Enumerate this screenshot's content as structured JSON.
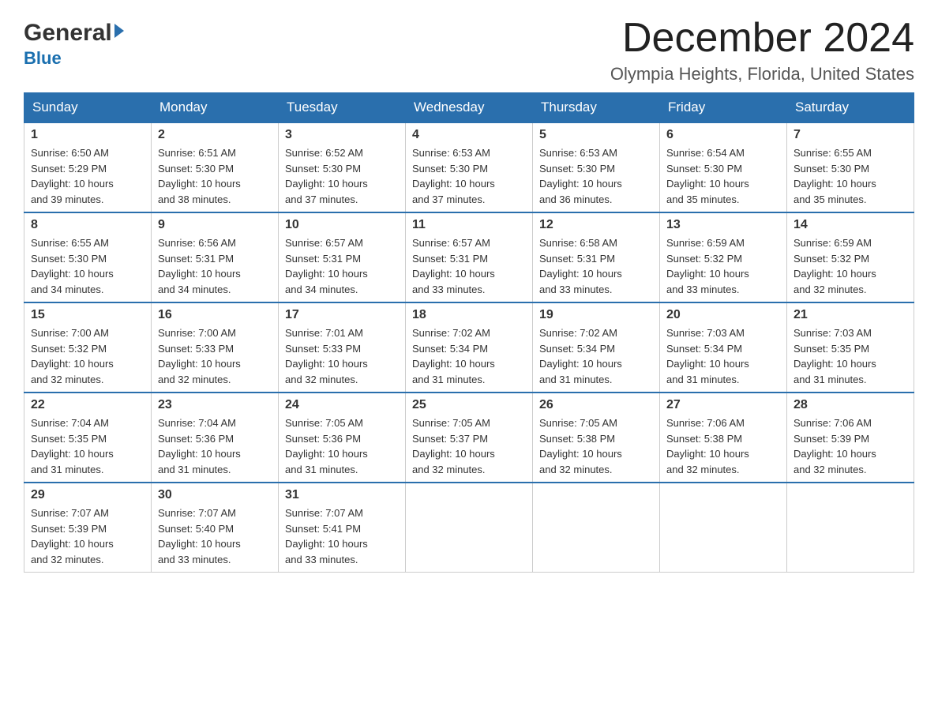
{
  "header": {
    "logo_general": "General",
    "logo_blue": "Blue",
    "month_title": "December 2024",
    "location": "Olympia Heights, Florida, United States"
  },
  "days_of_week": [
    "Sunday",
    "Monday",
    "Tuesday",
    "Wednesday",
    "Thursday",
    "Friday",
    "Saturday"
  ],
  "weeks": [
    [
      {
        "day": "1",
        "sunrise": "6:50 AM",
        "sunset": "5:29 PM",
        "daylight": "10 hours and 39 minutes."
      },
      {
        "day": "2",
        "sunrise": "6:51 AM",
        "sunset": "5:30 PM",
        "daylight": "10 hours and 38 minutes."
      },
      {
        "day": "3",
        "sunrise": "6:52 AM",
        "sunset": "5:30 PM",
        "daylight": "10 hours and 37 minutes."
      },
      {
        "day": "4",
        "sunrise": "6:53 AM",
        "sunset": "5:30 PM",
        "daylight": "10 hours and 37 minutes."
      },
      {
        "day": "5",
        "sunrise": "6:53 AM",
        "sunset": "5:30 PM",
        "daylight": "10 hours and 36 minutes."
      },
      {
        "day": "6",
        "sunrise": "6:54 AM",
        "sunset": "5:30 PM",
        "daylight": "10 hours and 35 minutes."
      },
      {
        "day": "7",
        "sunrise": "6:55 AM",
        "sunset": "5:30 PM",
        "daylight": "10 hours and 35 minutes."
      }
    ],
    [
      {
        "day": "8",
        "sunrise": "6:55 AM",
        "sunset": "5:30 PM",
        "daylight": "10 hours and 34 minutes."
      },
      {
        "day": "9",
        "sunrise": "6:56 AM",
        "sunset": "5:31 PM",
        "daylight": "10 hours and 34 minutes."
      },
      {
        "day": "10",
        "sunrise": "6:57 AM",
        "sunset": "5:31 PM",
        "daylight": "10 hours and 34 minutes."
      },
      {
        "day": "11",
        "sunrise": "6:57 AM",
        "sunset": "5:31 PM",
        "daylight": "10 hours and 33 minutes."
      },
      {
        "day": "12",
        "sunrise": "6:58 AM",
        "sunset": "5:31 PM",
        "daylight": "10 hours and 33 minutes."
      },
      {
        "day": "13",
        "sunrise": "6:59 AM",
        "sunset": "5:32 PM",
        "daylight": "10 hours and 33 minutes."
      },
      {
        "day": "14",
        "sunrise": "6:59 AM",
        "sunset": "5:32 PM",
        "daylight": "10 hours and 32 minutes."
      }
    ],
    [
      {
        "day": "15",
        "sunrise": "7:00 AM",
        "sunset": "5:32 PM",
        "daylight": "10 hours and 32 minutes."
      },
      {
        "day": "16",
        "sunrise": "7:00 AM",
        "sunset": "5:33 PM",
        "daylight": "10 hours and 32 minutes."
      },
      {
        "day": "17",
        "sunrise": "7:01 AM",
        "sunset": "5:33 PM",
        "daylight": "10 hours and 32 minutes."
      },
      {
        "day": "18",
        "sunrise": "7:02 AM",
        "sunset": "5:34 PM",
        "daylight": "10 hours and 31 minutes."
      },
      {
        "day": "19",
        "sunrise": "7:02 AM",
        "sunset": "5:34 PM",
        "daylight": "10 hours and 31 minutes."
      },
      {
        "day": "20",
        "sunrise": "7:03 AM",
        "sunset": "5:34 PM",
        "daylight": "10 hours and 31 minutes."
      },
      {
        "day": "21",
        "sunrise": "7:03 AM",
        "sunset": "5:35 PM",
        "daylight": "10 hours and 31 minutes."
      }
    ],
    [
      {
        "day": "22",
        "sunrise": "7:04 AM",
        "sunset": "5:35 PM",
        "daylight": "10 hours and 31 minutes."
      },
      {
        "day": "23",
        "sunrise": "7:04 AM",
        "sunset": "5:36 PM",
        "daylight": "10 hours and 31 minutes."
      },
      {
        "day": "24",
        "sunrise": "7:05 AM",
        "sunset": "5:36 PM",
        "daylight": "10 hours and 31 minutes."
      },
      {
        "day": "25",
        "sunrise": "7:05 AM",
        "sunset": "5:37 PM",
        "daylight": "10 hours and 32 minutes."
      },
      {
        "day": "26",
        "sunrise": "7:05 AM",
        "sunset": "5:38 PM",
        "daylight": "10 hours and 32 minutes."
      },
      {
        "day": "27",
        "sunrise": "7:06 AM",
        "sunset": "5:38 PM",
        "daylight": "10 hours and 32 minutes."
      },
      {
        "day": "28",
        "sunrise": "7:06 AM",
        "sunset": "5:39 PM",
        "daylight": "10 hours and 32 minutes."
      }
    ],
    [
      {
        "day": "29",
        "sunrise": "7:07 AM",
        "sunset": "5:39 PM",
        "daylight": "10 hours and 32 minutes."
      },
      {
        "day": "30",
        "sunrise": "7:07 AM",
        "sunset": "5:40 PM",
        "daylight": "10 hours and 33 minutes."
      },
      {
        "day": "31",
        "sunrise": "7:07 AM",
        "sunset": "5:41 PM",
        "daylight": "10 hours and 33 minutes."
      },
      null,
      null,
      null,
      null
    ]
  ],
  "labels": {
    "sunrise": "Sunrise:",
    "sunset": "Sunset:",
    "daylight": "Daylight:"
  }
}
